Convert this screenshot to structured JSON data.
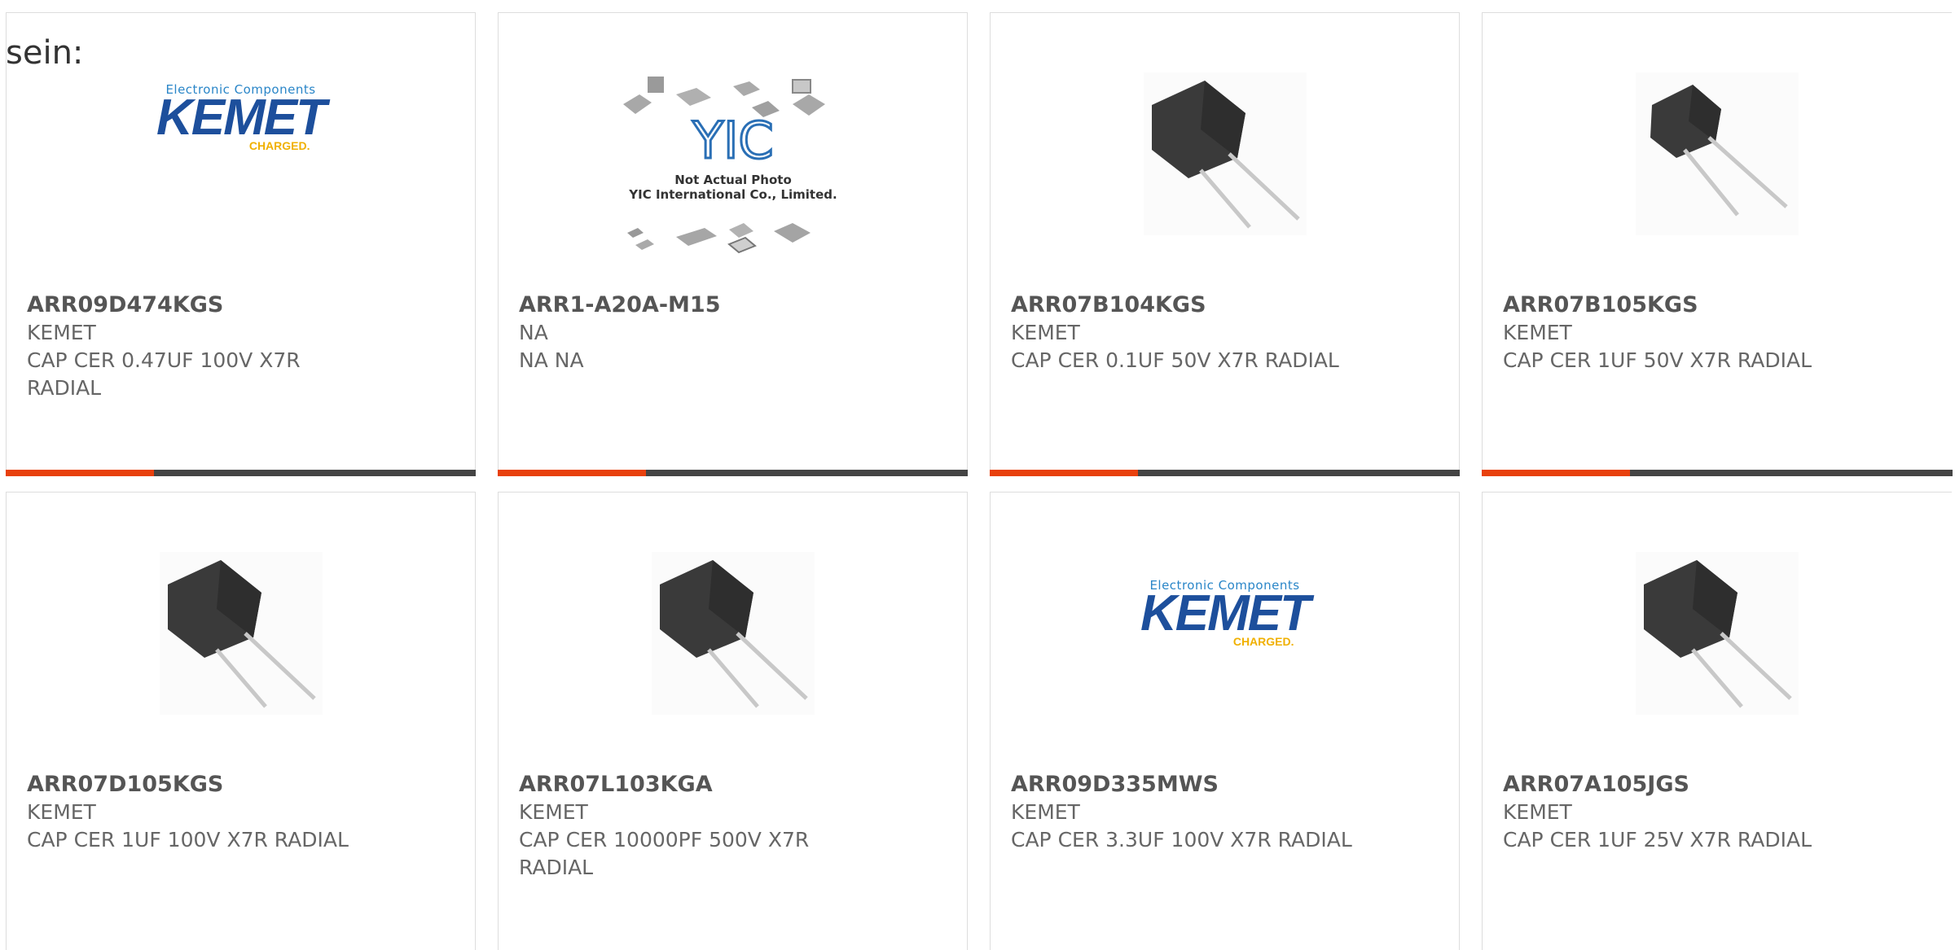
{
  "corner_text": "sein:",
  "colors": {
    "accent": "#e8400c",
    "bar": "#444444",
    "kemet_blue": "#1d4f9c",
    "kemet_yellow": "#f0b000"
  },
  "logos": {
    "kemet": {
      "subtitle": "Electronic Components",
      "brand": "KEMET",
      "tagline": "CHARGED."
    },
    "yic": {
      "brand": "YIC",
      "line1": "Not Actual Photo",
      "line2": "YIC International Co., Limited."
    }
  },
  "products": [
    {
      "part_number": "ARR09D474KGS",
      "manufacturer": "KEMET",
      "description": "CAP CER 0.47UF 100V X7R RADIAL",
      "image": "kemet-logo"
    },
    {
      "part_number": "ARR1-A20A-M15",
      "manufacturer": "NA",
      "description": "NA NA",
      "image": "yic-placeholder"
    },
    {
      "part_number": "ARR07B104KGS",
      "manufacturer": "KEMET",
      "description": "CAP CER 0.1UF 50V X7R RADIAL",
      "image": "radial-capacitor-photo"
    },
    {
      "part_number": "ARR07B105KGS",
      "manufacturer": "KEMET",
      "description": "CAP CER 1UF 50V X7R RADIAL",
      "image": "radial-capacitor-photo"
    },
    {
      "part_number": "ARR07D105KGS",
      "manufacturer": "KEMET",
      "description": "CAP CER 1UF 100V X7R RADIAL",
      "image": "radial-capacitor-photo"
    },
    {
      "part_number": "ARR07L103KGA",
      "manufacturer": "KEMET",
      "description": "CAP CER 10000PF 500V X7R RADIAL",
      "image": "radial-capacitor-photo"
    },
    {
      "part_number": "ARR09D335MWS",
      "manufacturer": "KEMET",
      "description": "CAP CER 3.3UF 100V X7R RADIAL",
      "image": "kemet-logo"
    },
    {
      "part_number": "ARR07A105JGS",
      "manufacturer": "KEMET",
      "description": "CAP CER 1UF 25V X7R RADIAL",
      "image": "radial-capacitor-photo"
    }
  ]
}
